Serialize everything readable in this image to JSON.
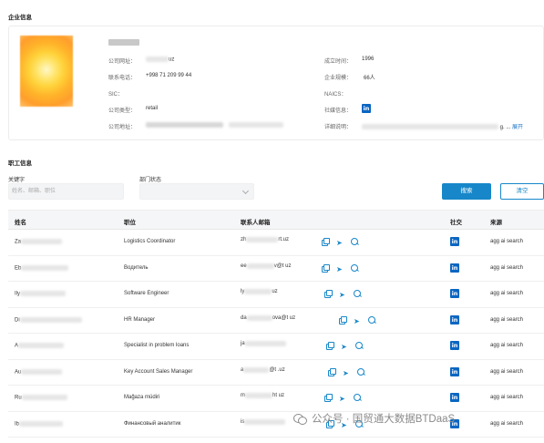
{
  "company_section": {
    "title": "企业信息",
    "left_fields": [
      {
        "label": "公司网址：",
        "value": "uz"
      },
      {
        "label": "联系电话：",
        "value": "+998 71 209 99 44"
      },
      {
        "label": "SIC：",
        "value": ""
      },
      {
        "label": "公司类型：",
        "value": "retail"
      },
      {
        "label": "公司地址：",
        "value": ""
      }
    ],
    "right_fields": [
      {
        "label": "成立时间：",
        "value": "1996"
      },
      {
        "label": "企业规模：",
        "value": "66人"
      },
      {
        "label": "NAICS：",
        "value": ""
      },
      {
        "label": "社媒信息：",
        "value": ""
      },
      {
        "label": "详细说明：",
        "value": "g. ..."
      }
    ],
    "expand_label": "展开",
    "linkedin_icon": "in"
  },
  "staff_section": {
    "title": "职工信息",
    "keyword_label": "关键字",
    "keyword_placeholder": "姓名、邮箱、职位",
    "dept_label": "部门状态",
    "search_button": "搜索",
    "clear_button": "清空",
    "columns": [
      "姓名",
      "职位",
      "联系人邮箱",
      "社交",
      "来源"
    ],
    "rows": [
      {
        "name": "Za",
        "position": "Logistics Coordinator",
        "email_prefix": "zh",
        "email_suffix": "rt.uz",
        "source": "agg ai search"
      },
      {
        "name": "Eb",
        "position": "Водитель",
        "email_prefix": "ee",
        "email_suffix": "v@t uz",
        "source": "agg ai search"
      },
      {
        "name": "Ily",
        "position": "Software Engineer",
        "email_prefix": "ly",
        "email_suffix": "uz",
        "source": "agg ai search"
      },
      {
        "name": "Di",
        "position": "HR Manager",
        "email_prefix": "da",
        "email_suffix": "ova@t uz",
        "source": "agg ai search"
      },
      {
        "name": "A",
        "position": "Specialist in problem loans",
        "email_prefix": "ja",
        "email_suffix": "",
        "source": "agg ai search"
      },
      {
        "name": "Au",
        "position": "Key Account Sales Manager",
        "email_prefix": "a",
        "email_suffix": "@t .uz",
        "source": "agg ai search"
      },
      {
        "name": "Ru",
        "position": "Mağaza müdiri",
        "email_prefix": "m",
        "email_suffix": "ht uz",
        "source": "agg ai search"
      },
      {
        "name": "Ib",
        "position": "Финансовый аналитик",
        "email_prefix": "is",
        "email_suffix": "",
        "source": "agg ai search"
      }
    ],
    "social_icon": "in"
  },
  "watermark": "公众号 · 国贸通大数据BTDaaS"
}
